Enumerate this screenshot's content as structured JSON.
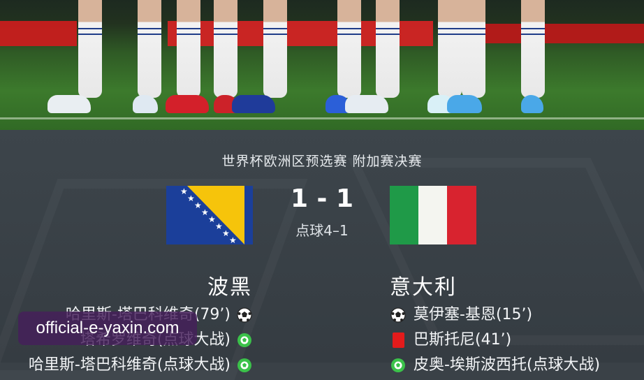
{
  "match": {
    "competition": "世界杯欧洲区预选赛 附加赛决赛",
    "score": "1 - 1",
    "penalty": "点球4–1",
    "home_team": "波黑",
    "away_team": "意大利",
    "home_flag_icon": "bosnia-herzegovina-flag-icon",
    "away_flag_icon": "italy-flag-icon"
  },
  "home_events": [
    {
      "text": "哈里斯-塔巴科维奇(79’)",
      "icon": "soccer-ball-icon"
    },
    {
      "text": "塔希罗维奇(点球大战)",
      "icon": "penalty-scored-icon"
    },
    {
      "text": "哈里斯-塔巴科维奇(点球大战)",
      "icon": "penalty-scored-icon"
    }
  ],
  "away_events": [
    {
      "text": "莫伊塞-基恩(15’)",
      "icon": "soccer-ball-icon"
    },
    {
      "text": "巴斯托尼(41’)",
      "icon": "red-card-icon"
    },
    {
      "text": "皮奥-埃斯波西托(点球大战)",
      "icon": "penalty-scored-icon"
    }
  ],
  "watermark": "official-e-yaxin.com",
  "colors": {
    "panel": "#3a4147",
    "red_card": "#e31b1b",
    "penalty_green": "#3bc24a",
    "bosnia_blue": "#1b3f9a",
    "bosnia_yellow": "#f6c40b",
    "italy_green": "#1f9a48",
    "italy_red": "#d8232f"
  }
}
